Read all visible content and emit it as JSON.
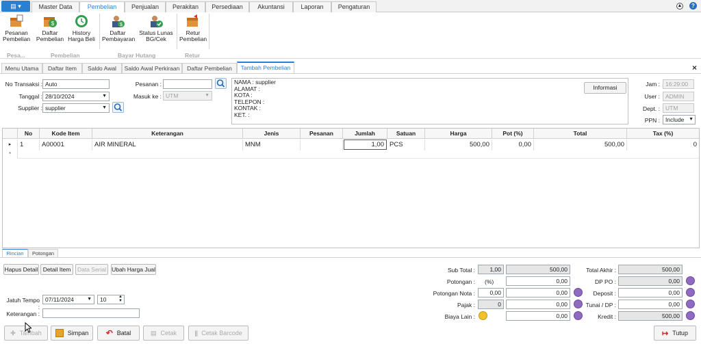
{
  "app_button": "▤ ▾",
  "menu_tabs": [
    "Master Data",
    "Pembelian",
    "Penjualan",
    "Perakitan",
    "Persediaan",
    "Akuntansi",
    "Laporan",
    "Pengaturan"
  ],
  "help_icons": [
    "up-arrow-icon",
    "help-icon"
  ],
  "ribbon": {
    "buttons": [
      {
        "label": "Pesanan\nPembelian",
        "icon": "order-box-icon"
      },
      {
        "label": "Daftar\nPembelian",
        "icon": "money-box-icon"
      },
      {
        "label": "History\nHarga Beli",
        "icon": "clock-icon"
      },
      {
        "label": "Daftar\nPembayaran",
        "icon": "user-money-icon"
      },
      {
        "label": "Status Lunas\nBG/Cek",
        "icon": "user-check-icon"
      },
      {
        "label": "Retur\nPembelian",
        "icon": "return-box-icon"
      }
    ],
    "groups": [
      "Pesa...",
      "Pembelian",
      "Bayar Hutang",
      "Retur"
    ]
  },
  "doc_tabs": [
    "Menu Utama",
    "Daftar Item",
    "Saldo Awal",
    "Saldo Awal Perkiraan",
    "Daftar Pembelian",
    "Tambah Pembelian"
  ],
  "close_glyph": "×",
  "form": {
    "no_transaksi_label": "No Transaksi :",
    "no_transaksi": "Auto",
    "tanggal_label": "Tanggal :",
    "tanggal": "28/10/2024",
    "supplier_label": "Supplier :",
    "supplier": "supplier",
    "pesanan_label": "Pesanan :",
    "pesanan": "",
    "masuk_ke_label": "Masuk ke :",
    "masuk_ke": "UTM",
    "info_lines": [
      "NAMA : supplier",
      "ALAMAT :",
      "KOTA :",
      "TELEPON :",
      "KONTAK :",
      "KET. :"
    ],
    "informasi_button": "Informasi",
    "jam_label": "Jam :",
    "jam": "16:29:00",
    "user_label": "User :",
    "user": "ADMIN",
    "dept_label": "Dept. :",
    "dept": "UTM",
    "ppn_label": "PPN :",
    "ppn": "Include"
  },
  "table": {
    "headers": [
      "No",
      "Kode Item",
      "Keterangan",
      "Jenis",
      "Pesanan",
      "Jumlah",
      "Satuan",
      "Harga",
      "Pot (%)",
      "Total",
      "Tax (%)"
    ],
    "rows": [
      {
        "no": "1",
        "kode": "A00001",
        "ket": "AIR MINERAL",
        "jenis": "MNM",
        "pesanan": "",
        "jumlah": "1,00",
        "satuan": "PCS",
        "harga": "500,00",
        "pot": "0,00",
        "total": "500,00",
        "tax": "0"
      }
    ],
    "row_marker": "▸",
    "new_row_marker": "*"
  },
  "bottom_tabs": [
    "Rincian",
    "Potongan"
  ],
  "detail_buttons": [
    "Hapus Detail",
    "Detail Item",
    "Data Serial",
    "Ubah Harga Jual"
  ],
  "jatuh_tempo_label": "Jatuh Tempo :",
  "jatuh_tempo": "07/11/2024",
  "tempo_days": "10",
  "keterangan_label": "Keterangan :",
  "keterangan": "",
  "summary": {
    "sub_total_label": "Sub Total :",
    "sub_total_qty": "1,00",
    "sub_total": "500,00",
    "potongan_label": "Potongan :",
    "potongan_pct": "(%)",
    "potongan": "0,00",
    "potongan_nota_label": "Potongan Nota :",
    "potongan_nota_a": "0,00",
    "potongan_nota": "0,00",
    "pajak_label": "Pajak :",
    "pajak_a": "0",
    "pajak": "0,00",
    "biaya_lain_label": "Biaya Lain :",
    "biaya_lain": "0,00",
    "total_akhir_label": "Total Akhir :",
    "total_akhir": "500,00",
    "dp_po_label": "DP PO :",
    "dp_po": "0,00",
    "deposit_label": "Deposit :",
    "deposit": "0,00",
    "tunai_label": "Tunai / DP :",
    "tunai": "0,00",
    "kredit_label": "Kredit :",
    "kredit": "500,00"
  },
  "footer_buttons": [
    "Tambah",
    "Simpan",
    "Batal",
    "Cetak",
    "Cetak Barcode",
    "Tutup"
  ],
  "colors": {
    "accent": "#2b7fd0",
    "purple": "#8e6bbf"
  }
}
